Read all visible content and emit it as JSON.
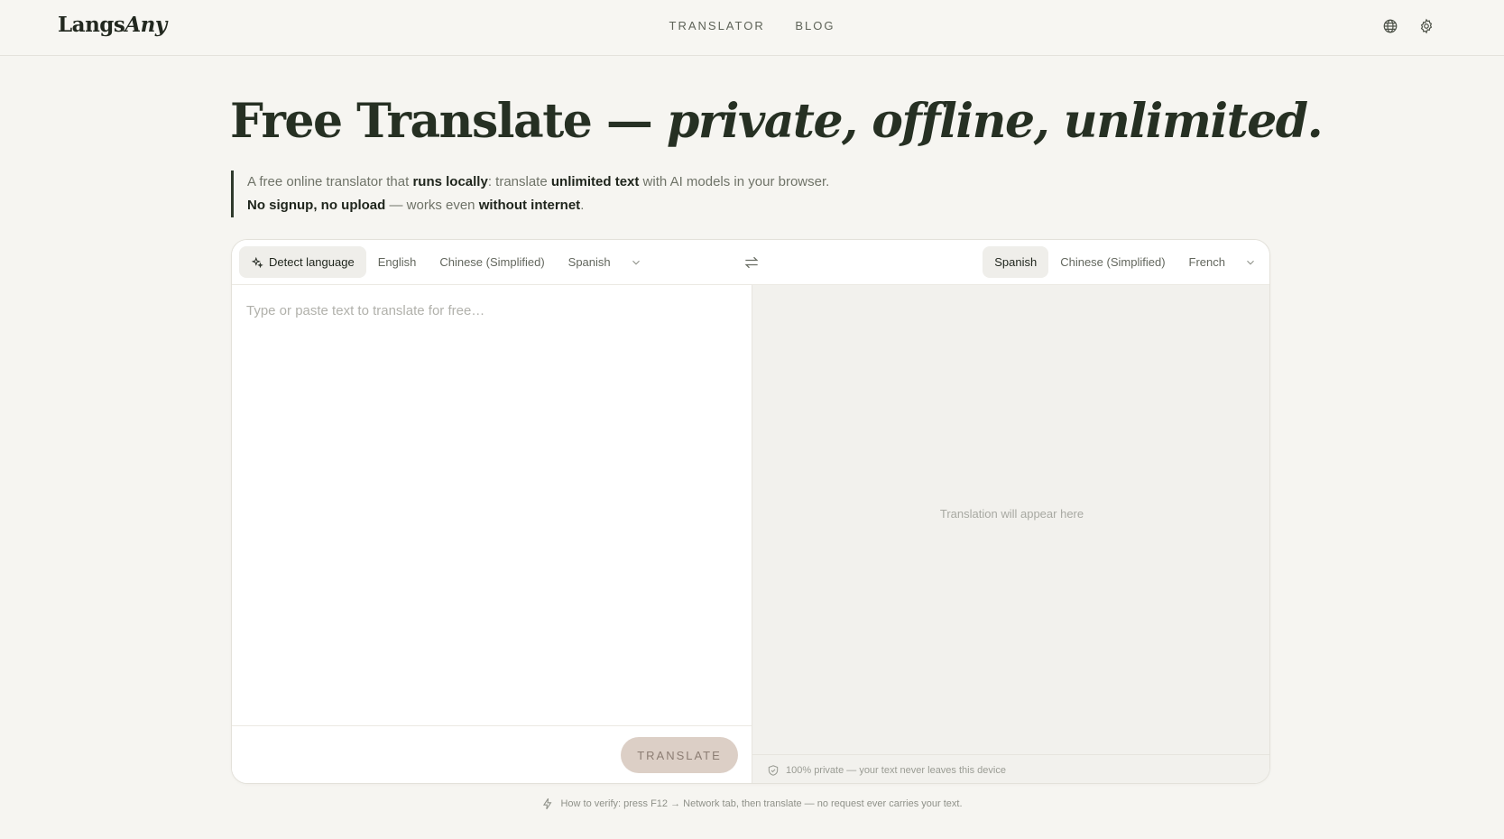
{
  "header": {
    "logo_main": "Langs",
    "logo_italic": "Any",
    "nav": [
      "TRANSLATOR",
      "BLOG"
    ],
    "icons": [
      "globe-icon",
      "gear-icon"
    ]
  },
  "hero": {
    "title_plain": "Free Translate — ",
    "title_italic": "private, offline, unlimited.",
    "line1": [
      {
        "t": "A free online translator that ",
        "b": false
      },
      {
        "t": "runs locally",
        "b": true
      },
      {
        "t": ": translate ",
        "b": false
      },
      {
        "t": "unlimited text",
        "b": true
      },
      {
        "t": " with AI models in your browser.",
        "b": false
      }
    ],
    "line2": [
      {
        "t": "No signup, no upload",
        "b": true
      },
      {
        "t": " — works even ",
        "b": false
      },
      {
        "t": "without internet",
        "b": true
      },
      {
        "t": ".",
        "b": false
      }
    ]
  },
  "source": {
    "detect_label": "Detect language",
    "languages": [
      "English",
      "Chinese (Simplified)",
      "Spanish"
    ],
    "placeholder": "Type or paste text to translate for free…",
    "value": "",
    "translate_label": "TRANSLATE"
  },
  "target": {
    "languages": [
      "Spanish",
      "Chinese (Simplified)",
      "French"
    ],
    "selected": "Spanish",
    "placeholder": "Translation will appear here",
    "privacy_note": "100% private — your text never leaves this device"
  },
  "footer": {
    "verify_note": "How to verify: press F12 → Network tab, then translate — no request ever carries your text."
  },
  "colors": {
    "background": "#f6f5f1",
    "accent_dark": "#263023",
    "translate_button": "#dccfc6",
    "target_pane": "#f2f1ed"
  }
}
